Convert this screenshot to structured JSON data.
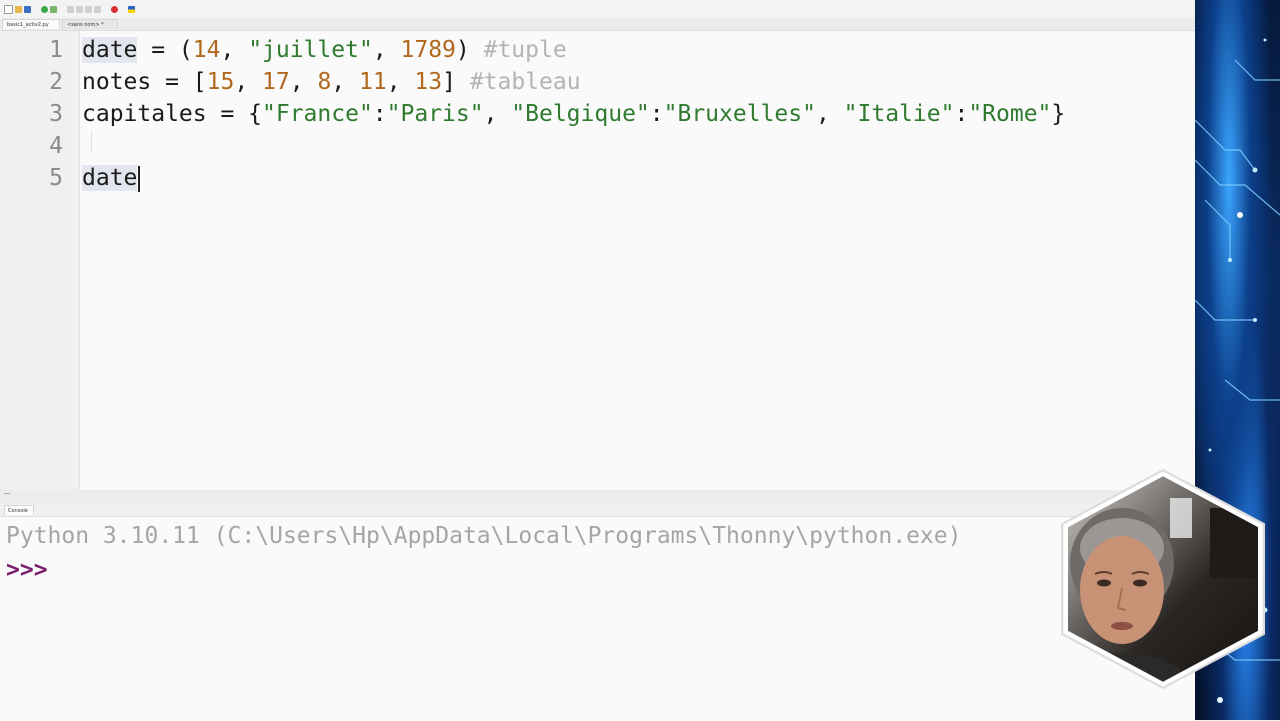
{
  "tabs": [
    {
      "label": "basic1_activ2.py"
    },
    {
      "label": "<sans nom> *"
    }
  ],
  "editor": {
    "line_numbers": [
      "1",
      "2",
      "3",
      "4",
      "5"
    ],
    "line1": {
      "name": "date",
      "op": " = (",
      "n1": "14",
      "c1": ", ",
      "s1": "\"juillet\"",
      "c2": ", ",
      "n2": "1789",
      "close": ") ",
      "comment": "#tuple"
    },
    "line2": {
      "name": "notes = [",
      "n1": "15",
      "c1": ", ",
      "n2": "17",
      "c2": ", ",
      "n3": "8",
      "c3": ", ",
      "n4": "11",
      "c4": ", ",
      "n5": "13",
      "close": "] ",
      "comment": "#tableau"
    },
    "line3": {
      "name": "capitales = {",
      "k1": "\"France\"",
      "sep1": ":",
      "v1": "\"Paris\"",
      "c1": ", ",
      "k2": "\"Belgique\"",
      "sep2": ":",
      "v2": "\"Bruxelles\"",
      "c2": ", ",
      "k3": "\"Italie\"",
      "sep3": ":",
      "v3": "\"Rome\"",
      "close": "}"
    },
    "line5": "date"
  },
  "console": {
    "tab_label": "Console",
    "banner": "Python 3.10.11 (C:\\Users\\Hp\\AppData\\Local\\Programs\\Thonny\\python.exe)",
    "prompt": ">>>"
  },
  "colors": {
    "number": "#b0681e",
    "string": "#2f7a2f",
    "comment": "#b3b3b3",
    "prompt": "#7a1f6e"
  },
  "icons": [
    "new-file-icon",
    "open-file-icon",
    "save-icon",
    "run-icon",
    "debug-icon",
    "step-over-icon",
    "step-into-icon",
    "step-out-icon",
    "resume-icon",
    "stop-icon",
    "flag-icon"
  ]
}
